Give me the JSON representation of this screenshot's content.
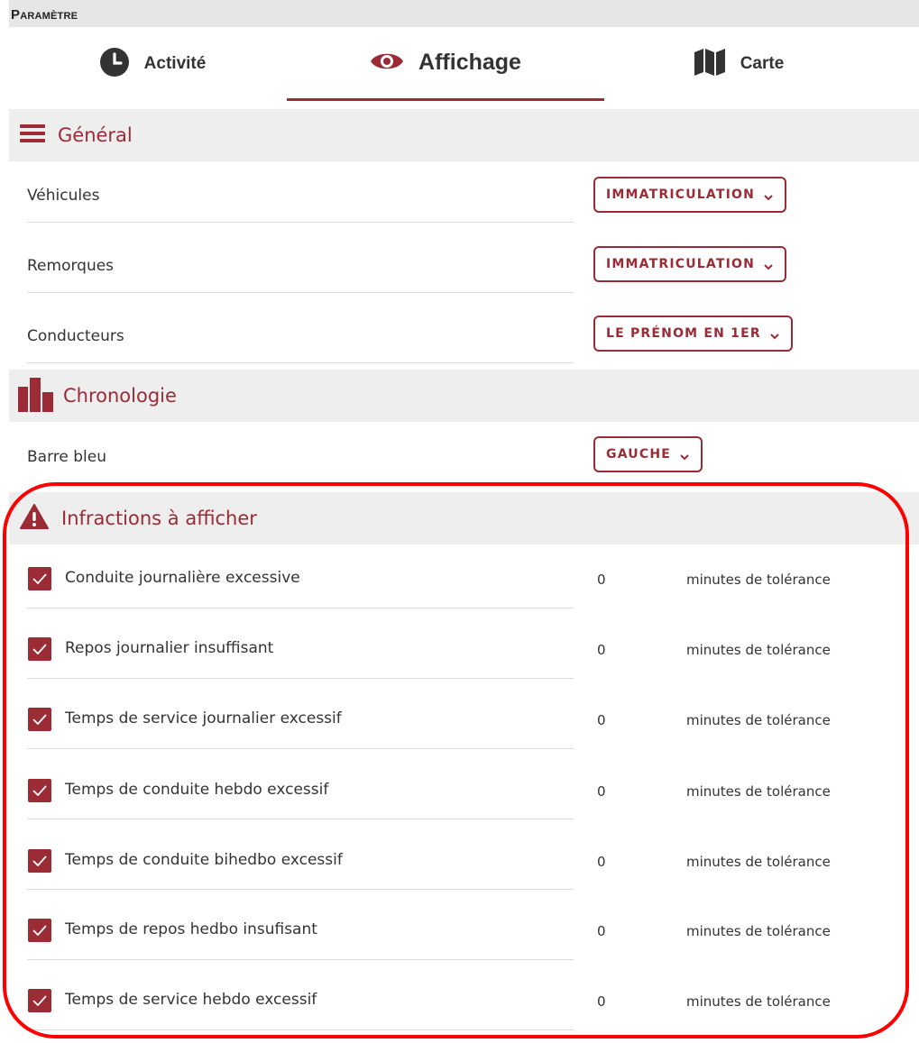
{
  "header": {
    "title": "Paramètre"
  },
  "tabs": [
    {
      "label": "Activité",
      "icon": "clock-icon"
    },
    {
      "label": "Affichage",
      "icon": "eye-icon",
      "active": true
    },
    {
      "label": "Carte",
      "icon": "map-icon"
    }
  ],
  "general": {
    "title": "Général",
    "icon": "menu-icon",
    "rows": [
      {
        "label": "Véhicules",
        "value": "IMMATRICULATION"
      },
      {
        "label": "Remorques",
        "value": "IMMATRICULATION"
      },
      {
        "label": "Conducteurs",
        "value": "LE PRÉNOM EN 1ER"
      }
    ]
  },
  "chronologie": {
    "title": "Chronologie",
    "icon": "timeline-bars-icon",
    "rows": [
      {
        "label": "Barre bleu",
        "value": "GAUCHE"
      }
    ]
  },
  "infractions": {
    "title": "Infractions à afficher",
    "icon": "warning-icon",
    "unit_label": "minutes de tolérance",
    "items": [
      {
        "label": "Conduite journalière excessive",
        "checked": true,
        "tolerance": "0"
      },
      {
        "label": "Repos journalier insuffisant",
        "checked": true,
        "tolerance": "0"
      },
      {
        "label": "Temps de service journalier excessif",
        "checked": true,
        "tolerance": "0"
      },
      {
        "label": "Temps de conduite hebdo excessif",
        "checked": true,
        "tolerance": "0"
      },
      {
        "label": "Temps de conduite bihedbo excessif",
        "checked": true,
        "tolerance": "0"
      },
      {
        "label": "Temps de repos hedbo insufisant",
        "checked": true,
        "tolerance": "0"
      },
      {
        "label": "Temps de service hebdo excessif",
        "checked": true,
        "tolerance": "0"
      }
    ]
  },
  "colors": {
    "accent": "#9b2b35",
    "highlight": "#ff0000",
    "section_bg": "#eeeeee",
    "topbar_bg": "#e6e6e6"
  }
}
